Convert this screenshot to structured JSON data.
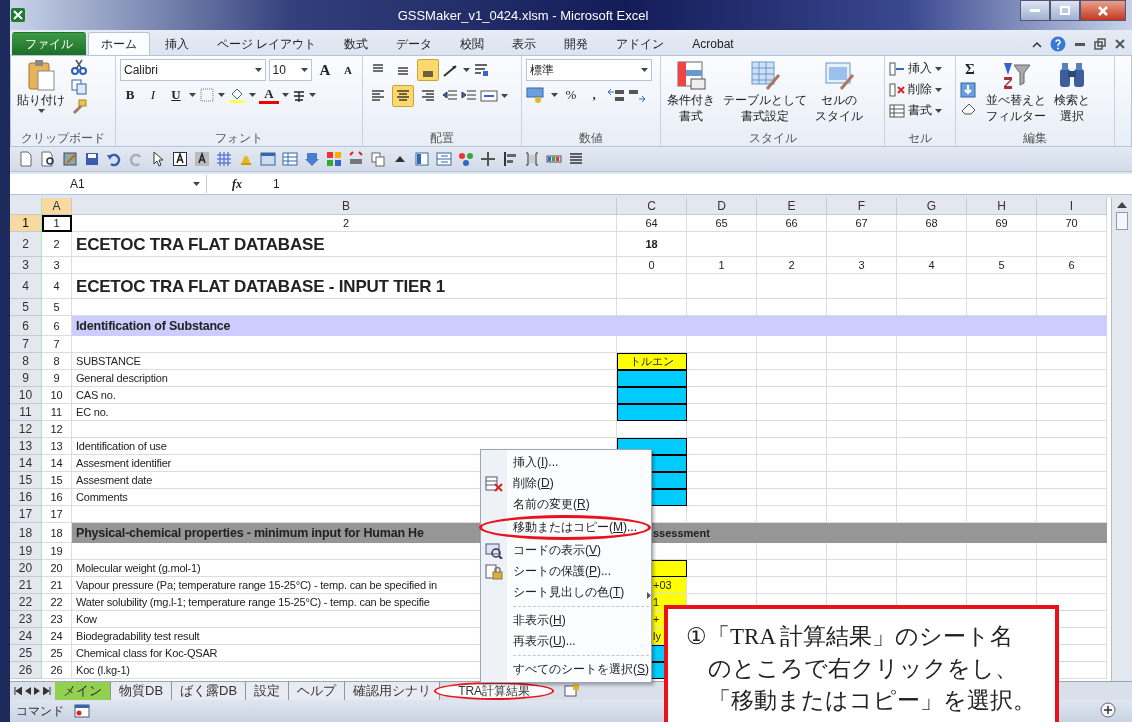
{
  "window": {
    "title": "GSSMaker_v1_0424.xlsm - Microsoft Excel"
  },
  "ribbon_tabs": [
    {
      "label": "ファイル",
      "kind": "file",
      "selected": false
    },
    {
      "label": "ホーム",
      "kind": "tab",
      "selected": true
    },
    {
      "label": "挿入",
      "kind": "tab",
      "selected": false
    },
    {
      "label": "ページ レイアウト",
      "kind": "tab",
      "selected": false
    },
    {
      "label": "数式",
      "kind": "tab",
      "selected": false
    },
    {
      "label": "データ",
      "kind": "tab",
      "selected": false
    },
    {
      "label": "校閲",
      "kind": "tab",
      "selected": false
    },
    {
      "label": "表示",
      "kind": "tab",
      "selected": false
    },
    {
      "label": "開発",
      "kind": "tab",
      "selected": false
    },
    {
      "label": "アドイン",
      "kind": "tab",
      "selected": false
    },
    {
      "label": "Acrobat",
      "kind": "tab",
      "selected": false
    }
  ],
  "ribbon": {
    "clipboard": {
      "label": "クリップボード",
      "paste": "貼り付け"
    },
    "font": {
      "label": "フォント",
      "name": "Calibri",
      "size": "10",
      "grow": "A",
      "shrink": "A",
      "bold": "B",
      "italic": "I",
      "underline": "U",
      "color_letter": "A"
    },
    "alignment": {
      "label": "配置",
      "buttons": [
        {
          "kind": "top",
          "selected": false
        },
        {
          "kind": "middle",
          "selected": false
        },
        {
          "kind": "bottom",
          "selected": true
        },
        {
          "kind": "left",
          "selected": false
        },
        {
          "kind": "center",
          "selected": true
        },
        {
          "kind": "right",
          "selected": false
        }
      ]
    },
    "number": {
      "label": "数値",
      "format": "標準",
      "percent": "%",
      "comma": ","
    },
    "styles": {
      "label": "スタイル",
      "buttons": [
        {
          "kind": "conditional",
          "lines": [
            "条件付き",
            "書式"
          ]
        },
        {
          "kind": "table",
          "lines": [
            "テーブルとして",
            "書式設定"
          ]
        },
        {
          "kind": "cellstyle",
          "lines": [
            "セルの",
            "スタイル"
          ]
        }
      ]
    },
    "cells": {
      "label": "セル",
      "buttons": [
        {
          "kind": "insert",
          "label": "挿入"
        },
        {
          "kind": "delete",
          "label": "削除"
        },
        {
          "kind": "format",
          "label": "書式"
        }
      ]
    },
    "editing": {
      "label": "編集",
      "sum": "Σ",
      "buttons": [
        {
          "kind": "sort",
          "lines": [
            "並べ替えと",
            "フィルター"
          ]
        },
        {
          "kind": "find",
          "lines": [
            "検索と",
            "選択"
          ]
        }
      ]
    }
  },
  "formula_bar": {
    "name_box": "A1",
    "fx": "fx",
    "value": "1"
  },
  "columns": [
    {
      "label": "A",
      "selected": true
    },
    {
      "label": "B",
      "selected": false
    },
    {
      "label": "C",
      "selected": false
    },
    {
      "label": "D",
      "selected": false
    },
    {
      "label": "E",
      "selected": false
    },
    {
      "label": "F",
      "selected": false
    },
    {
      "label": "G",
      "selected": false
    },
    {
      "label": "H",
      "selected": false
    },
    {
      "label": "I",
      "selected": false
    }
  ],
  "rows": [
    {
      "number": "1",
      "selected": true,
      "kind": "index",
      "a": "1",
      "b": "2",
      "cells": [
        {
          "text": "64"
        },
        {
          "text": "65"
        },
        {
          "text": "66"
        },
        {
          "text": "67"
        },
        {
          "text": "68"
        },
        {
          "text": "69"
        },
        {
          "text": "70"
        }
      ]
    },
    {
      "number": "2",
      "selected": false,
      "kind": "title",
      "a": "2",
      "b": "ECETOC TRA FLAT DATABASE",
      "cells": [
        {
          "text": "18",
          "bold": true
        }
      ]
    },
    {
      "number": "3",
      "selected": false,
      "kind": "index",
      "a": "3",
      "cells": [
        {
          "text": "0"
        },
        {
          "text": "1"
        },
        {
          "text": "2"
        },
        {
          "text": "3"
        },
        {
          "text": "4"
        },
        {
          "text": "5"
        },
        {
          "text": "6"
        }
      ]
    },
    {
      "number": "4",
      "selected": false,
      "kind": "title",
      "a": "4",
      "b": "ECETOC TRA FLAT DATABASE - INPUT TIER 1"
    },
    {
      "number": "5",
      "selected": false,
      "kind": "plain",
      "a": "5"
    },
    {
      "number": "6",
      "selected": false,
      "kind": "band",
      "color": "#ccccff",
      "a": "6",
      "b": "Identification of Substance"
    },
    {
      "number": "7",
      "selected": false,
      "kind": "plain",
      "a": "7"
    },
    {
      "number": "8",
      "selected": false,
      "kind": "plain",
      "a": "8",
      "b": "SUBSTANCE",
      "cells": [
        {
          "text": "トルエン",
          "color": "#ffff00"
        }
      ]
    },
    {
      "number": "9",
      "selected": false,
      "kind": "plain",
      "a": "9",
      "b": "General description",
      "cells": [
        {
          "color": "#00ccff"
        }
      ]
    },
    {
      "number": "10",
      "selected": false,
      "kind": "plain",
      "a": "10",
      "b": "CAS no.",
      "cells": [
        {
          "color": "#00ccff"
        }
      ]
    },
    {
      "number": "11",
      "selected": false,
      "kind": "plain",
      "a": "11",
      "b": "EC no.",
      "cells": [
        {
          "color": "#00ccff"
        }
      ]
    },
    {
      "number": "12",
      "selected": false,
      "kind": "plain",
      "a": "12"
    },
    {
      "number": "13",
      "selected": false,
      "kind": "plain",
      "a": "13",
      "b": "Identification of use",
      "cells": [
        {
          "color": "#00ccff"
        }
      ]
    },
    {
      "number": "14",
      "selected": false,
      "kind": "plain",
      "a": "14",
      "b": "Assesment identifier",
      "cells": [
        {
          "color": "#00ccff"
        }
      ]
    },
    {
      "number": "15",
      "selected": false,
      "kind": "plain",
      "a": "15",
      "b": "Assesment date",
      "cells": [
        {
          "color": "#00ccff"
        }
      ]
    },
    {
      "number": "16",
      "selected": false,
      "kind": "plain",
      "a": "16",
      "b": "Comments",
      "cells": [
        {
          "color": "#00ccff"
        }
      ]
    },
    {
      "number": "17",
      "selected": false,
      "kind": "plain",
      "a": "17"
    },
    {
      "number": "18",
      "selected": false,
      "kind": "band",
      "color": "#969696",
      "a": "18",
      "b": "Physical-chemical properties - minimum input for Human He",
      "cells": [
        {
          "text": "ssessment",
          "kind": "partial",
          "bold": true
        }
      ]
    },
    {
      "number": "19",
      "selected": false,
      "kind": "plain",
      "a": "19"
    },
    {
      "number": "20",
      "selected": false,
      "kind": "plain",
      "a": "20",
      "b": "Molecular weight (g.mol-1)",
      "cells": [
        {
          "color": "#ffff00"
        }
      ]
    },
    {
      "number": "21",
      "selected": false,
      "kind": "plain",
      "a": "21",
      "b": "Vapour pressure (Pa; temperature range 15-25°C) - temp. can be specified in",
      "cells": [
        {
          "text": "+03",
          "kind": "partial",
          "color": "#ffff00"
        }
      ]
    },
    {
      "number": "22",
      "selected": false,
      "kind": "plain",
      "a": "22",
      "b": "Water solubility (mg.l-1; temperature range 15-25°C) - temp. can be specifie",
      "cells": [
        {
          "text": "1",
          "kind": "partial",
          "color": "#ffff00"
        }
      ]
    },
    {
      "number": "23",
      "selected": false,
      "kind": "plain",
      "a": "23",
      "b": "Kow",
      "cells": [
        {
          "text": "+",
          "kind": "partial",
          "color": "#ffff00"
        }
      ]
    },
    {
      "number": "24",
      "selected": false,
      "kind": "plain",
      "a": "24",
      "b": "Biodegradability test result",
      "cells": [
        {
          "text": "ly",
          "kind": "partial",
          "color": "#ffff00"
        }
      ]
    },
    {
      "number": "25",
      "selected": false,
      "kind": "plain",
      "a": "25",
      "b": "Chemical class for Koc-QSAR",
      "cells": [
        {
          "color": "#00ccff"
        }
      ]
    },
    {
      "number": "26",
      "selected": false,
      "kind": "plain",
      "a": "26",
      "b": "Koc (l.kg-1)",
      "cells": [
        {
          "color": "#00ccff"
        }
      ]
    }
  ],
  "context_menu": {
    "items": [
      {
        "kind": "item",
        "before": "挿入(",
        "key": "I",
        "after": ")...",
        "annotated": false
      },
      {
        "kind": "delete",
        "before": "削除(",
        "key": "D",
        "after": ")",
        "annotated": false
      },
      {
        "kind": "item",
        "before": "名前の変更(",
        "key": "R",
        "after": ")",
        "annotated": false
      },
      {
        "kind": "item",
        "before": "移動またはコピー(",
        "key": "M",
        "after": ")...",
        "annotated": true
      },
      {
        "kind": "code",
        "before": "コードの表示(",
        "key": "V",
        "after": ")",
        "annotated": false
      },
      {
        "kind": "protect",
        "before": "シートの保護(",
        "key": "P",
        "after": ")...",
        "annotated": false
      },
      {
        "kind": "submenu",
        "before": "シート見出しの色(",
        "key": "T",
        "after": ")",
        "annotated": false
      },
      {
        "kind": "separator"
      },
      {
        "kind": "item",
        "before": "非表示(",
        "key": "H",
        "after": ")",
        "annotated": false
      },
      {
        "kind": "item",
        "before": "再表示(",
        "key": "U",
        "after": ")...",
        "annotated": false
      },
      {
        "kind": "separator"
      },
      {
        "kind": "item",
        "before": "すべてのシートを選択(",
        "key": "S",
        "after": ")",
        "annotated": false
      }
    ]
  },
  "sheet_tabs": [
    {
      "label": "メイン",
      "color": "#92d050",
      "selected": false,
      "annotated": false
    },
    {
      "label": "物質DB",
      "selected": false,
      "annotated": false
    },
    {
      "label": "ばく露DB",
      "selected": false,
      "annotated": false
    },
    {
      "label": "設定",
      "selected": false,
      "annotated": false
    },
    {
      "label": "ヘルプ",
      "selected": false,
      "annotated": false
    },
    {
      "label": "確認用シナリ",
      "selected": false,
      "annotated": false
    },
    {
      "label": "TRA計算結果",
      "selected": true,
      "annotated": true
    }
  ],
  "status_bar": {
    "mode": "コマンド"
  },
  "callout": {
    "lines": [
      "①「TRA 計算結果」のシート名",
      "のところで右クリックをし、",
      "「移動またはコピー」を選択。"
    ]
  }
}
